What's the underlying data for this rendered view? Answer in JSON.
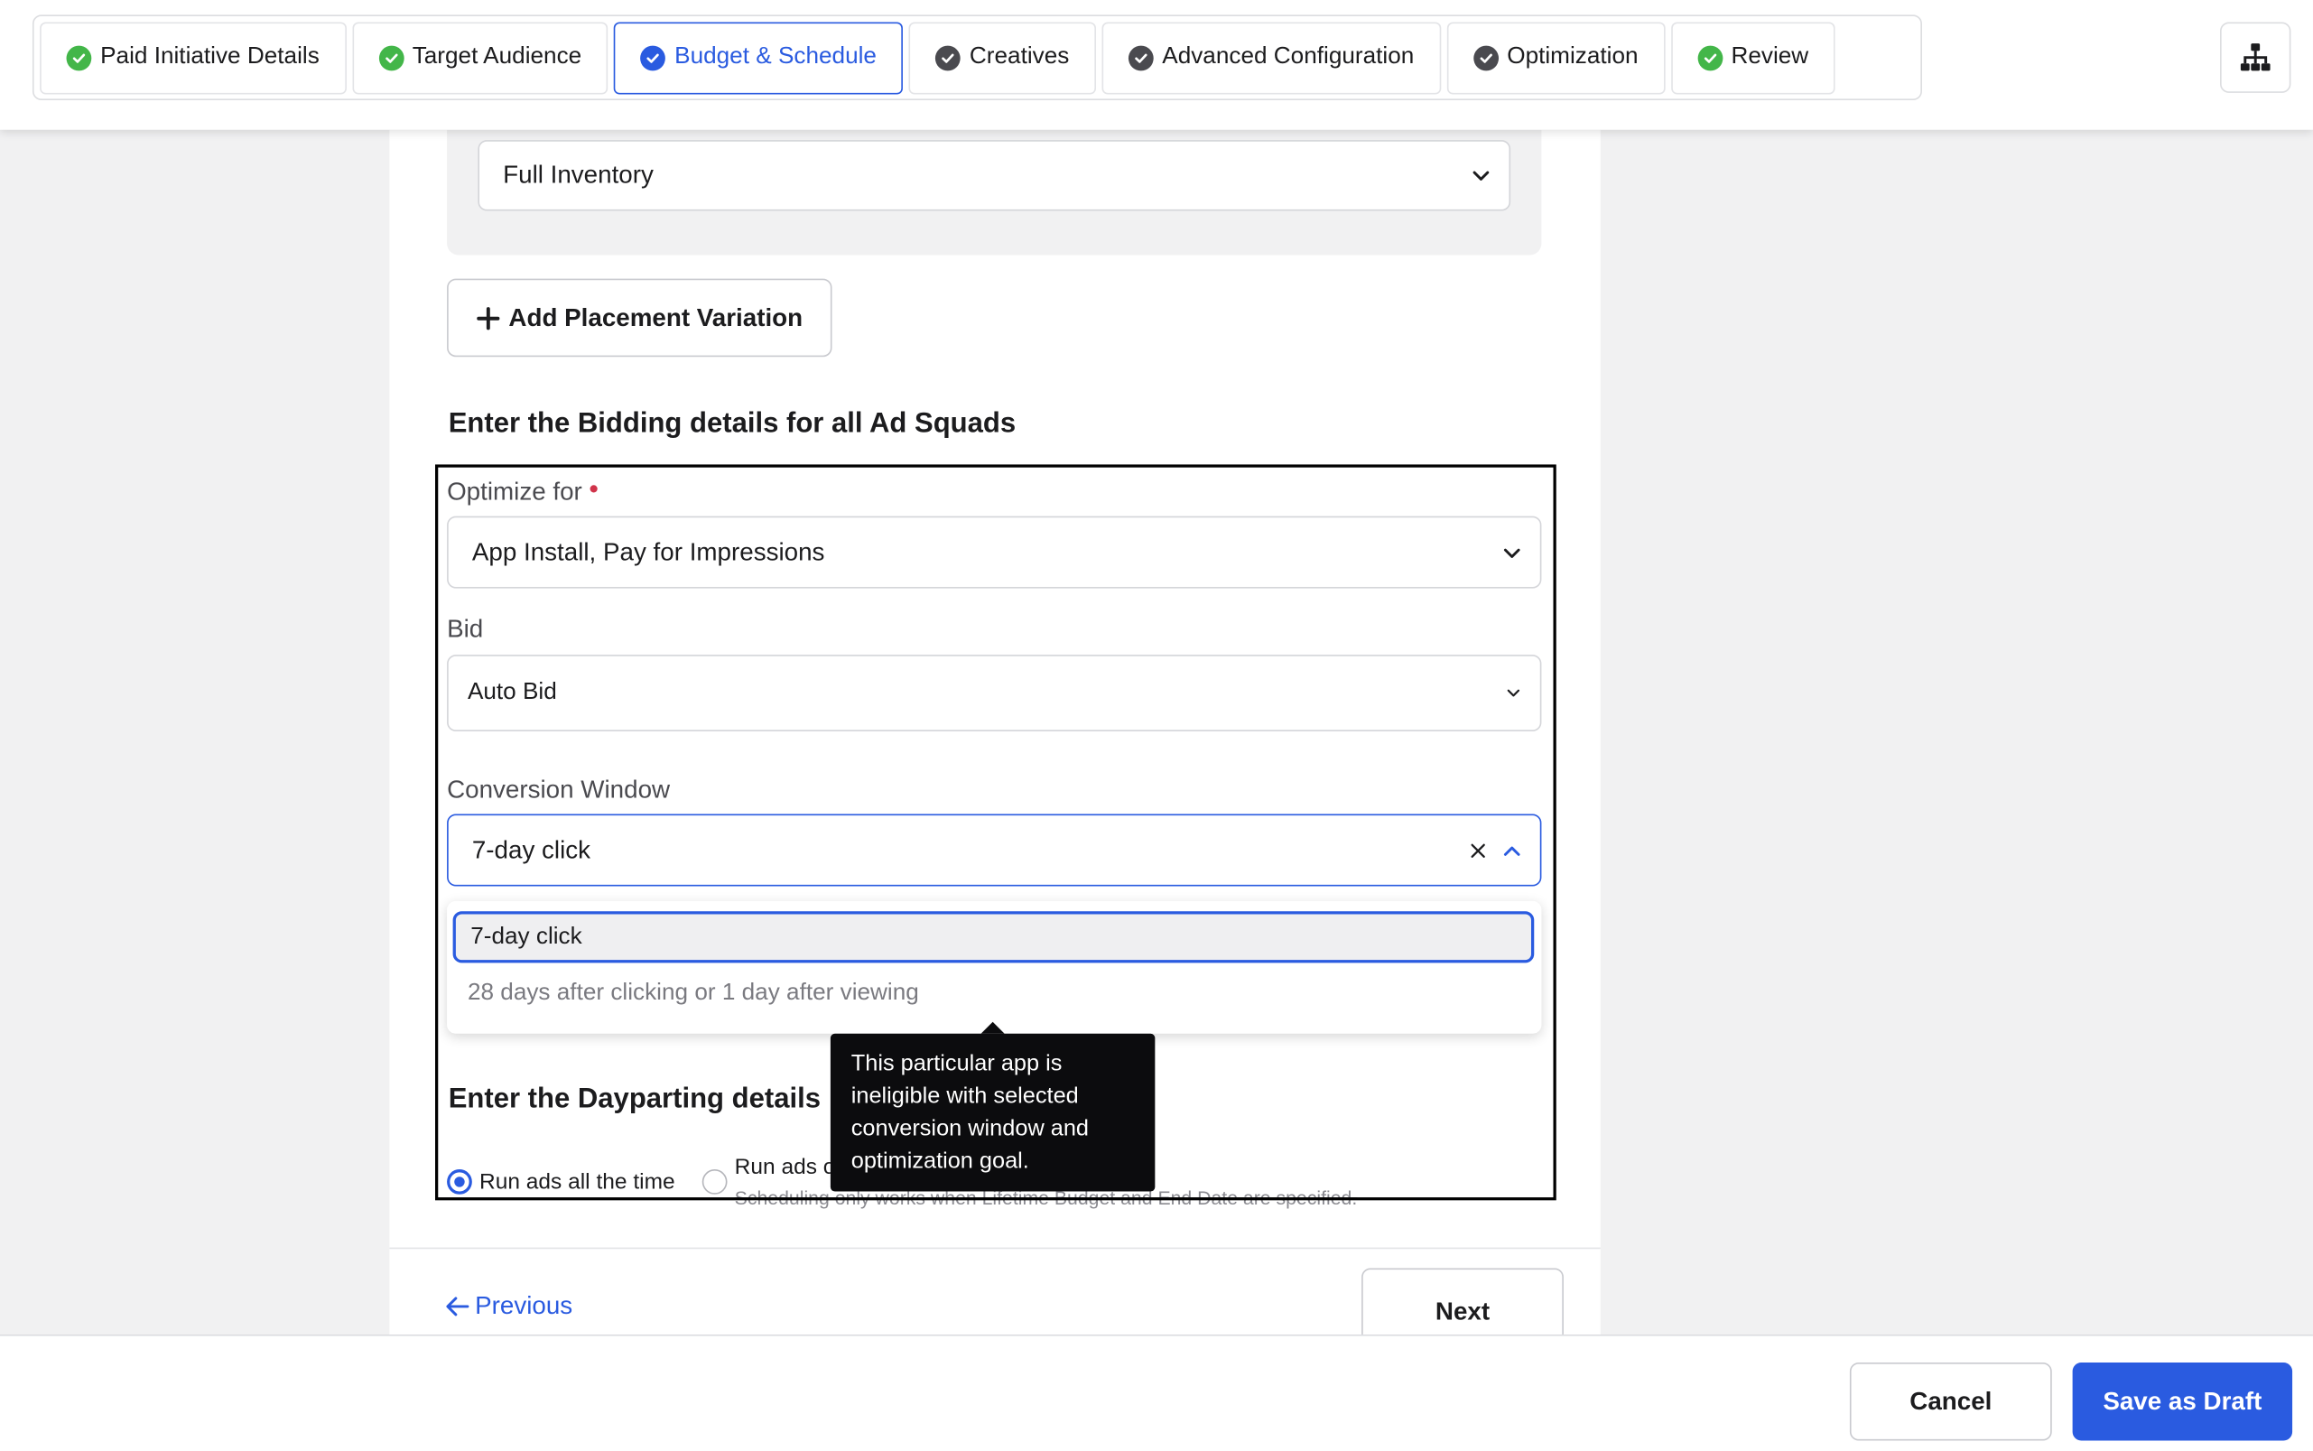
{
  "colors": {
    "accent": "#2a5be0",
    "success": "#43b649",
    "tooltip_bg": "#0c0c0e",
    "required": "#d0334a"
  },
  "tabs": [
    {
      "label": "Paid Initiative Details",
      "status": "complete",
      "icon": "check-circle-icon"
    },
    {
      "label": "Target Audience",
      "status": "complete",
      "icon": "check-circle-icon"
    },
    {
      "label": "Budget & Schedule",
      "status": "active",
      "icon": "check-circle-icon"
    },
    {
      "label": "Creatives",
      "status": "visited",
      "icon": "check-circle-icon"
    },
    {
      "label": "Advanced Configuration",
      "status": "visited",
      "icon": "check-circle-icon"
    },
    {
      "label": "Optimization",
      "status": "visited",
      "icon": "check-circle-icon"
    },
    {
      "label": "Review",
      "status": "complete",
      "icon": "check-circle-icon"
    }
  ],
  "header": {
    "hierarchy_icon": "hierarchy-icon"
  },
  "placement": {
    "inventory_value": "Full Inventory",
    "add_variation_label": "Add Placement Variation"
  },
  "bidding": {
    "title": "Enter the Bidding details for all Ad Squads",
    "optimize_label": "Optimize for",
    "optimize_value": "App Install, Pay for Impressions",
    "bid_label": "Bid",
    "bid_value": "Auto Bid",
    "conversion_label": "Conversion Window",
    "conversion_value": "7-day click",
    "conversion_options": [
      {
        "label": "7-day click",
        "selected": true,
        "disabled": false
      },
      {
        "label": "28 days after clicking or 1 day after viewing",
        "selected": false,
        "disabled": true
      }
    ],
    "tooltip": "This particular app is ineligible with selected conversion window and optimization goal."
  },
  "dayparting": {
    "title": "Enter the Dayparting details",
    "option_all_time": "Run ads all the time",
    "option_schedule": "Run ads o",
    "schedule_note": "Scheduling only works when Lifetime Budget and End Date are specified."
  },
  "nav": {
    "previous_label": "Previous",
    "next_label": "Next"
  },
  "footer": {
    "cancel_label": "Cancel",
    "save_label": "Save as Draft"
  }
}
